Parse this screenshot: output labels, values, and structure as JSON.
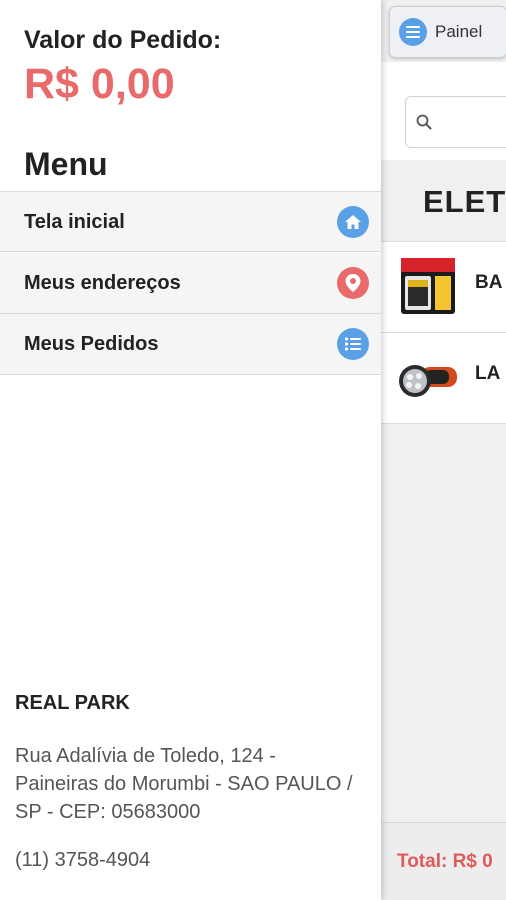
{
  "side_menu": {
    "order_label": "Valor do Pedido:",
    "order_value": "R$ 0,00",
    "menu_title": "Menu",
    "items": [
      {
        "label": "Tela inicial",
        "icon": "home-icon",
        "icon_color": "#5aa0e6"
      },
      {
        "label": "Meus endereços",
        "icon": "map-pin-icon",
        "icon_color": "#e86a6a"
      },
      {
        "label": "Meus Pedidos",
        "icon": "list-icon",
        "icon_color": "#5aa0e6"
      }
    ],
    "store": {
      "name": "REAL PARK",
      "address": "Rua Adalívia de Toledo, 124 - Paineiras do Morumbi - SAO PAULO / SP - CEP: 05683000",
      "phone": "(11) 3758-4904"
    }
  },
  "main": {
    "panel_button_label": "Painel",
    "category_title": "ELET",
    "products": [
      {
        "name": "BA",
        "thumb": "battery-image"
      },
      {
        "name": "LA",
        "thumb": "flashlight-image"
      }
    ],
    "footer_total": "Total: R$ 0"
  },
  "colors": {
    "accent_red": "#e86a6a",
    "accent_blue": "#5aa0e6"
  }
}
